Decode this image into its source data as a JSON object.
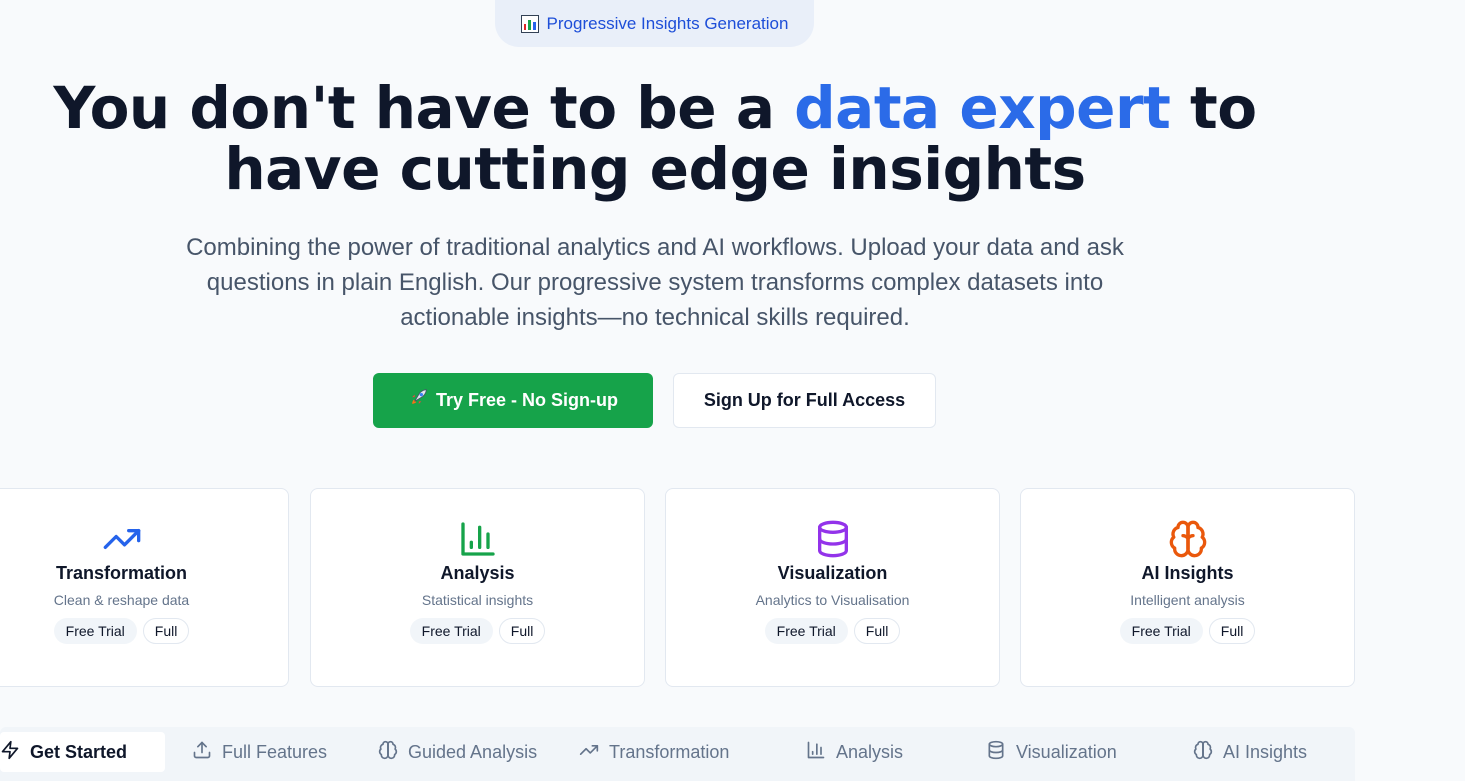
{
  "badge": {
    "label": "Progressive Insights Generation",
    "icon": "bar-chart-emoji-icon"
  },
  "hero": {
    "headline_part1": "You don't have to be a ",
    "headline_highlight": "data expert",
    "headline_part2": " to have cutting edge insights",
    "subtitle": "Combining the power of traditional analytics and AI workflows. Upload your data and ask questions in plain English. Our progressive system transforms complex datasets into actionable insights—no technical skills required.",
    "highlight_color": "#2b6be8"
  },
  "cta": {
    "primary_label": "Try Free - No Sign-up",
    "primary_icon": "rocket-icon",
    "primary_color": "#16a34a",
    "secondary_label": "Sign Up for Full Access"
  },
  "features": [
    {
      "title": "Transformation",
      "desc": "Clean & reshape data",
      "icon": "trending-up-icon",
      "color": "#2563eb",
      "tags": [
        "Free Trial",
        "Full"
      ]
    },
    {
      "title": "Analysis",
      "desc": "Statistical insights",
      "icon": "bar-chart-icon",
      "color": "#16a34a",
      "tags": [
        "Free Trial",
        "Full"
      ]
    },
    {
      "title": "Visualization",
      "desc": "Analytics to Visualisation",
      "icon": "database-icon",
      "color": "#9333ea",
      "tags": [
        "Free Trial",
        "Full"
      ]
    },
    {
      "title": "AI Insights",
      "desc": "Intelligent analysis",
      "icon": "brain-icon",
      "color": "#ea580c",
      "tags": [
        "Free Trial",
        "Full"
      ]
    }
  ],
  "tabs": [
    {
      "label": "Get Started",
      "icon": "zap-icon",
      "active": true
    },
    {
      "label": "Full Features",
      "icon": "upload-icon",
      "active": false
    },
    {
      "label": "Guided Analysis",
      "icon": "brain-icon",
      "active": false
    },
    {
      "label": "Transformation",
      "icon": "trending-up-icon",
      "active": false
    },
    {
      "label": "Analysis",
      "icon": "bar-chart-icon",
      "active": false
    },
    {
      "label": "Visualization",
      "icon": "database-icon",
      "active": false
    },
    {
      "label": "AI Insights",
      "icon": "brain-icon",
      "active": false
    }
  ]
}
